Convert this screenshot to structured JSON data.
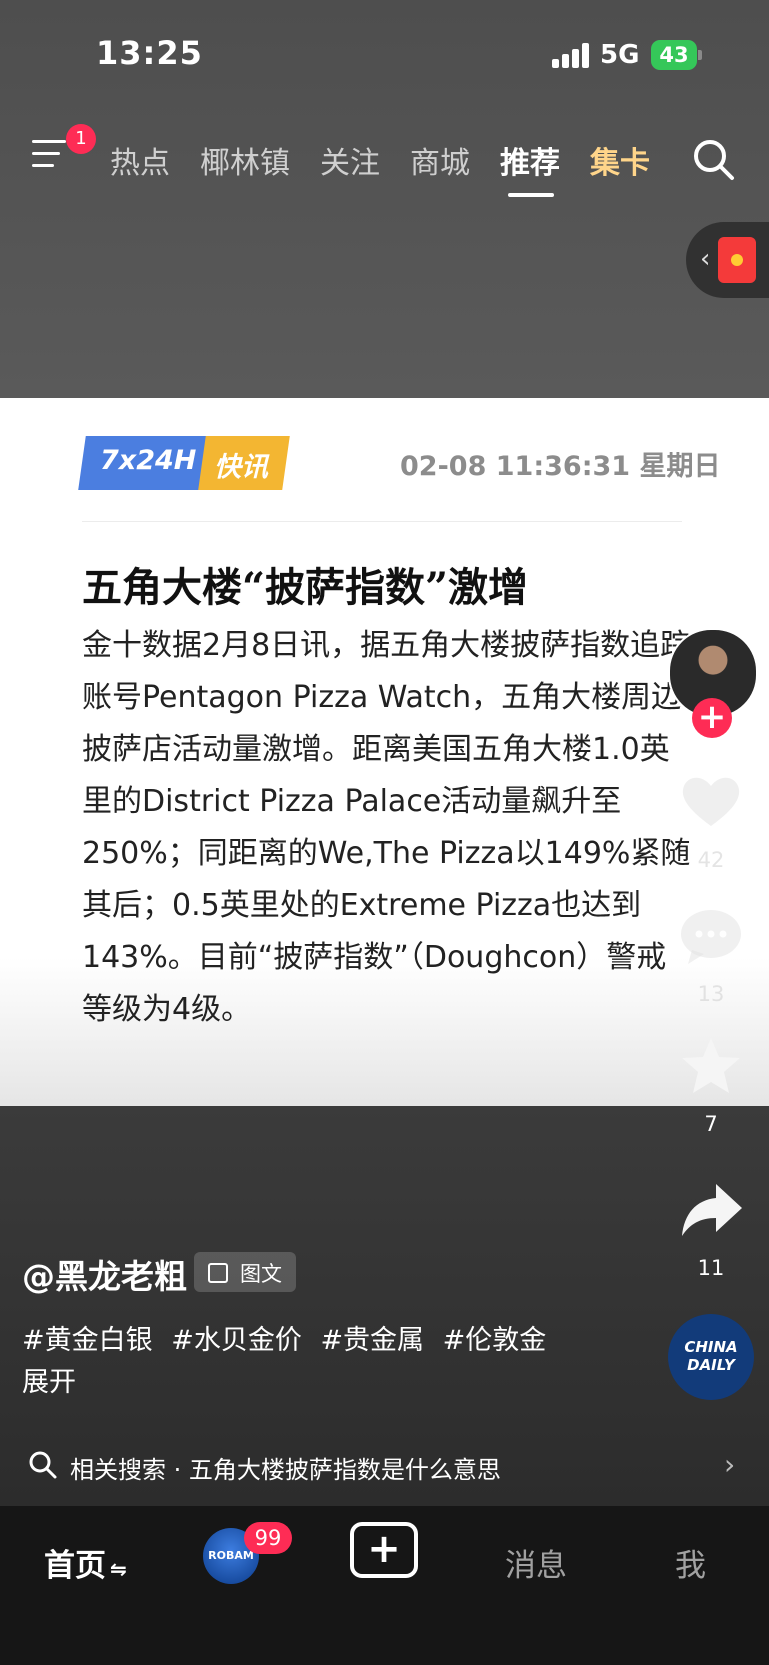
{
  "status_bar": {
    "time": "13:25",
    "network": "5G",
    "battery": "43"
  },
  "top_nav": {
    "menu_badge": "1",
    "tabs": [
      {
        "label": "热点"
      },
      {
        "label": "椰林镇"
      },
      {
        "label": "关注"
      },
      {
        "label": "商城"
      },
      {
        "label": "推荐",
        "active": true
      },
      {
        "label": "集卡",
        "highlight_color": "#ffd58a"
      }
    ]
  },
  "post": {
    "badge": {
      "left": "7x24H",
      "right": "快讯",
      "left_color": "#4b7ee0",
      "right_color": "#f3b632"
    },
    "datetime": "02-08 11:36:31 星期日",
    "headline": "五角大楼“披萨指数”激增",
    "body": "金十数据2月8日讯，据五角大楼披萨指数追踪账号Pentagon Pizza Watch，五角大楼周边披萨店活动量激增。距离美国五角大楼1.0英里的District Pizza Palace活动量飙升至250%；同距离的We,The Pizza以149%紧随其后；0.5英里处的Extreme Pizza也达到143%。目前“披萨指数”（Doughcon）警戒等级为4级。"
  },
  "rail": {
    "likes": "42",
    "comments": "13",
    "favorites": "7",
    "shares": "11"
  },
  "author": {
    "name": "@黑龙老粗",
    "content_type": "图文"
  },
  "tags": [
    "#黄金白银",
    "#水贝金价",
    "#贵金属",
    "#伦敦金"
  ],
  "expand_label": "展开",
  "music_disc_text": "CHINA DAILY",
  "related_search": {
    "label": "相关搜索 · 五角大楼披萨指数是什么意思"
  },
  "bottom_nav": {
    "home": "首页",
    "robam_text": "ROBAM",
    "robam_badge": "99",
    "create_symbol": "+",
    "messages": "消息",
    "me": "我"
  }
}
